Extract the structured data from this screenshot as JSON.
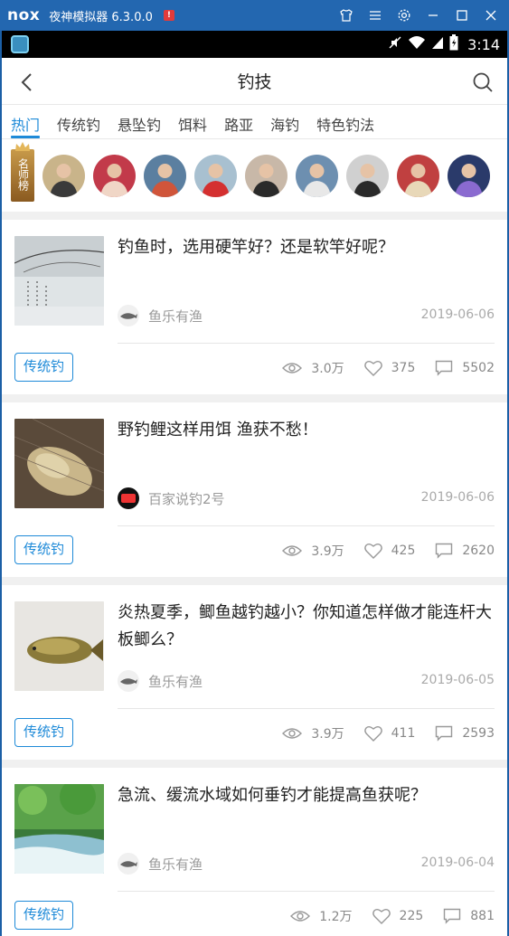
{
  "emulator": {
    "logo": "nox",
    "title": "夜神模拟器 6.3.0.0",
    "badge": "!"
  },
  "status_bar": {
    "time": "3:14"
  },
  "app_bar": {
    "title": "钓技"
  },
  "tabs": [
    {
      "label": "热门",
      "active": true
    },
    {
      "label": "传统钓",
      "active": false
    },
    {
      "label": "悬坠钓",
      "active": false
    },
    {
      "label": "饵料",
      "active": false
    },
    {
      "label": "路亚",
      "active": false
    },
    {
      "label": "海钓",
      "active": false
    },
    {
      "label": "特色钓法",
      "active": false
    }
  ],
  "masters": {
    "badge_label": "名师榜",
    "avatars": [
      {
        "bg": "#c9b48a",
        "fg": "#3a3a3a"
      },
      {
        "bg": "#c23a4a",
        "fg": "#f0d6c6"
      },
      {
        "bg": "#5b7fa0",
        "fg": "#d0553a"
      },
      {
        "bg": "#a8c0d0",
        "fg": "#d43030"
      },
      {
        "bg": "#c8b8a8",
        "fg": "#2a2a2a"
      },
      {
        "bg": "#6d8fb0",
        "fg": "#e8e8e8"
      },
      {
        "bg": "#d0d0d0",
        "fg": "#2a2a2a"
      },
      {
        "bg": "#c04040",
        "fg": "#e8d8b8"
      },
      {
        "bg": "#2a3a6a",
        "fg": "#8a6ad0"
      }
    ]
  },
  "articles": [
    {
      "title": "钓鱼时，选用硬竿好？还是软竿好呢？",
      "author": "鱼乐有渔",
      "date": "2019-06-06",
      "tag": "传统钓",
      "views": "3.0万",
      "likes": "375",
      "comments": "5502",
      "thumb": "snow"
    },
    {
      "title": "野钓鲤这样用饵 渔获不愁！",
      "author": "百家说钓2号",
      "date": "2019-06-06",
      "tag": "传统钓",
      "views": "3.9万",
      "likes": "425",
      "comments": "2620",
      "thumb": "carp"
    },
    {
      "title": "炎热夏季，鲫鱼越钓越小？你知道怎样做才能连杆大板鲫么？",
      "author": "鱼乐有渔",
      "date": "2019-06-05",
      "tag": "传统钓",
      "views": "3.9万",
      "likes": "411",
      "comments": "2593",
      "thumb": "crucian"
    },
    {
      "title": "急流、缓流水域如何垂钓才能提高鱼获呢？",
      "author": "鱼乐有渔",
      "date": "2019-06-04",
      "tag": "传统钓",
      "views": "1.2万",
      "likes": "225",
      "comments": "881",
      "thumb": "stream"
    }
  ],
  "colors": {
    "accent": "#1e8ad8",
    "emulator_bar": "#2367b0",
    "muted_text": "#9a9a9a"
  }
}
